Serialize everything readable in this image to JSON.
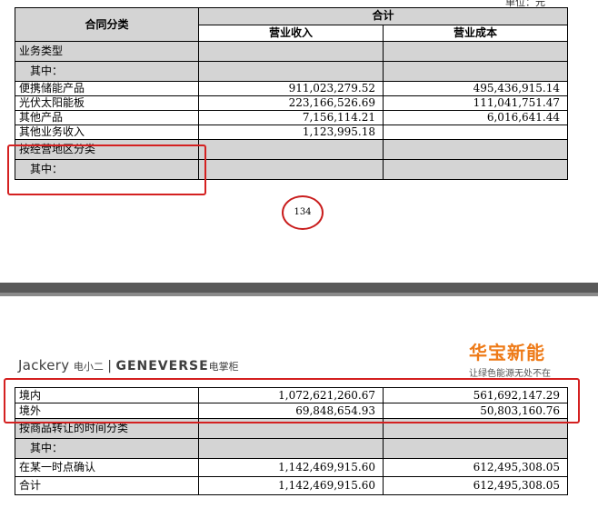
{
  "unit_label": "单位：元",
  "table1": {
    "header_category": "合同分类",
    "header_total": "合计",
    "header_revenue": "营业收入",
    "header_cost": "营业成本",
    "rows": [
      {
        "label": "业务类型",
        "revenue": "",
        "cost": "",
        "gray": true
      },
      {
        "label": "其中：",
        "revenue": "",
        "cost": "",
        "gray": true
      },
      {
        "label": "便携储能产品",
        "revenue": "911,023,279.52",
        "cost": "495,436,915.14",
        "gray": false
      },
      {
        "label": "光伏太阳能板",
        "revenue": "223,166,526.69",
        "cost": "111,041,751.47",
        "gray": false
      },
      {
        "label": "其他产品",
        "revenue": "7,156,114.21",
        "cost": "6,016,641.44",
        "gray": false
      },
      {
        "label": "其他业务收入",
        "revenue": "1,123,995.18",
        "cost": "",
        "gray": false
      },
      {
        "label": "按经营地区分类",
        "revenue": "",
        "cost": "",
        "gray": true
      },
      {
        "label": "其中：",
        "revenue": "",
        "cost": "",
        "gray": true
      }
    ]
  },
  "page_number": "134",
  "header_brand": {
    "left_brand1": "Jackery",
    "left_brand1_cn": "电小二",
    "left_brand2": "GENEVERSE",
    "left_brand2_cn": "电掌柜",
    "right_cn": "华宝新能",
    "right_slogan": "让绿色能源无处不在"
  },
  "table2": {
    "rows": [
      {
        "label": "境内",
        "revenue": "1,072,621,260.67",
        "cost": "561,692,147.29",
        "gray": false
      },
      {
        "label": "境外",
        "revenue": "69,848,654.93",
        "cost": "50,803,160.76",
        "gray": false
      },
      {
        "label": "按商品转让的时间分类",
        "revenue": "",
        "cost": "",
        "gray": true
      },
      {
        "label": "其中：",
        "revenue": "",
        "cost": "",
        "gray": true
      },
      {
        "label": "在某一时点确认",
        "revenue": "1,142,469,915.60",
        "cost": "612,495,308.05",
        "gray": false
      },
      {
        "label": "合计",
        "revenue": "1,142,469,915.60",
        "cost": "612,495,308.05",
        "gray": false
      }
    ]
  },
  "colors": {
    "highlight_red": "#d42020",
    "brand_orange": "#ee7a17",
    "cell_gray": "#d4d4d4"
  }
}
